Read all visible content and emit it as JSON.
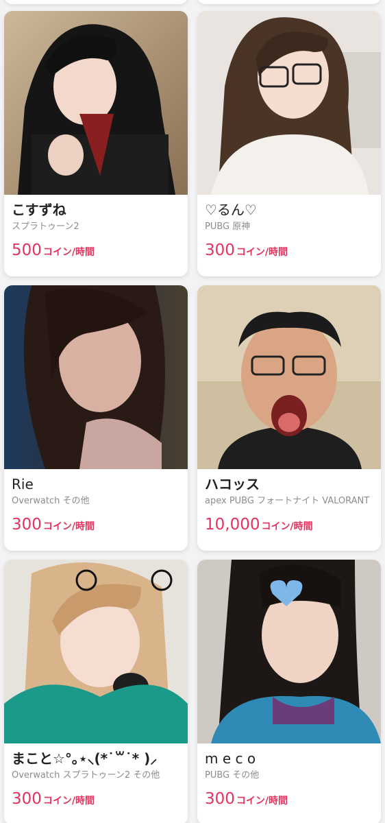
{
  "cards": [
    {
      "name": "こすずね",
      "games": "スプラトゥーン2",
      "price": "500",
      "unit": "コイン/時間"
    },
    {
      "name": "♡るん♡",
      "games": "PUBG 原神",
      "price": "300",
      "unit": "コイン/時間"
    },
    {
      "name": "Rie",
      "games": "Overwatch その他",
      "price": "300",
      "unit": "コイン/時間"
    },
    {
      "name": "ハコッス",
      "games": "apex PUBG フォートナイト VALORANT",
      "price": "10,000",
      "unit": "コイン/時間"
    },
    {
      "name": "まこと☆°｡⋆⸜(*˙꒳˙* )⸝",
      "games": "Overwatch スプラトゥーン2 その他",
      "price": "300",
      "unit": "コイン/時間"
    },
    {
      "name": "m e c o",
      "games": "PUBG その他",
      "price": "300",
      "unit": "コイン/時間"
    }
  ],
  "colors": {
    "accent": "#e3335e",
    "background": "#f3f3f5",
    "card": "#ffffff",
    "name_text": "#222222",
    "games_text": "#8c8c8c"
  }
}
